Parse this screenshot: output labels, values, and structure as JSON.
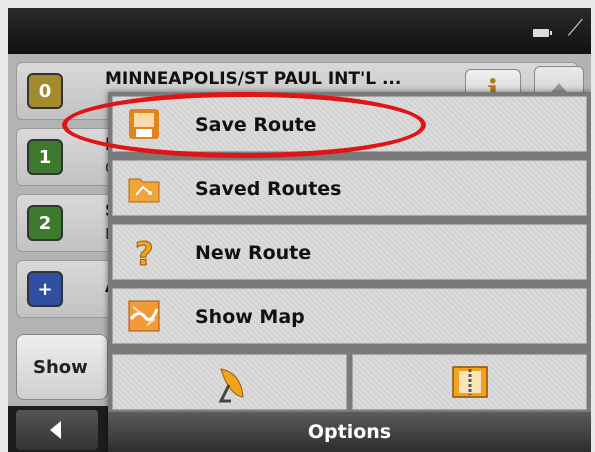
{
  "routes": [
    {
      "index": "0",
      "title": "MINNEAPOLIS/ST PAUL INT'L ...",
      "sub": "",
      "color": "#a38a2c"
    },
    {
      "index": "1",
      "title": "D",
      "sub": "C",
      "color": "#3e7a2d"
    },
    {
      "index": "2",
      "title": "S",
      "sub": "E",
      "color": "#3e7a2d"
    },
    {
      "index": "+",
      "title": "A",
      "sub": "",
      "color": "#2f4fa3"
    }
  ],
  "info_label": "i",
  "show_label": "Show",
  "menu": {
    "items": [
      {
        "label": "Save Route",
        "icon": "save-route-icon"
      },
      {
        "label": "Saved Routes",
        "icon": "saved-routes-folder-icon"
      },
      {
        "label": "New Route",
        "icon": "question-mark-icon"
      },
      {
        "label": "Show Map",
        "icon": "map-icon"
      }
    ],
    "gps_icon": "satellite-dish-icon",
    "book_icon": "address-book-icon",
    "footer": "Options"
  },
  "highlight_color": "#e01414"
}
